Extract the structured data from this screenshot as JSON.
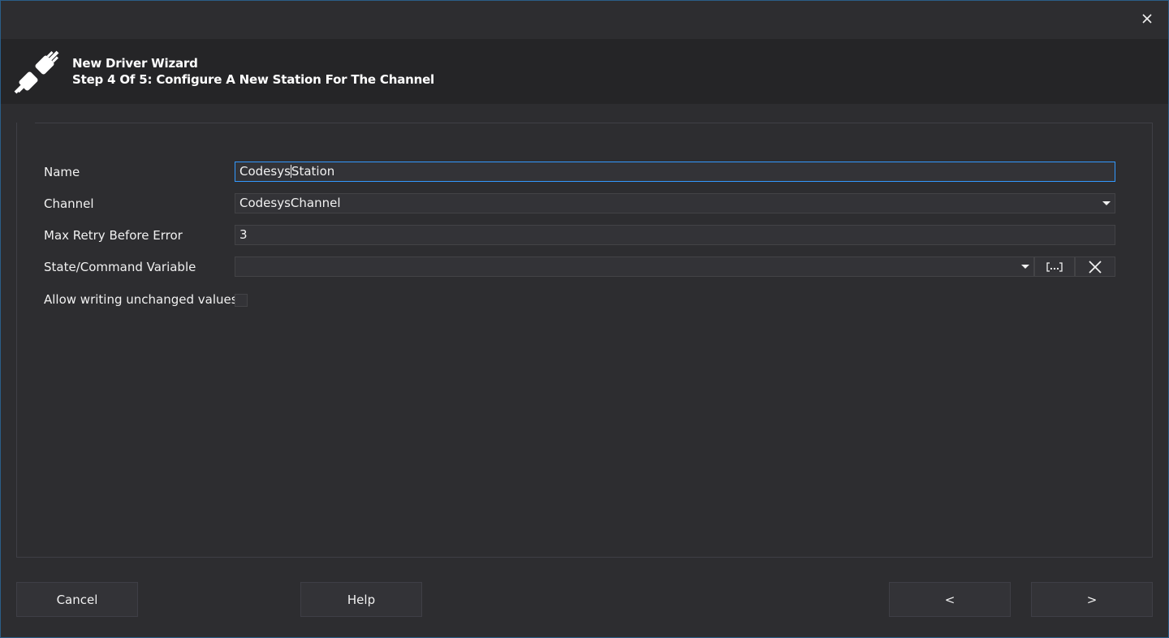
{
  "window": {
    "close_icon": "close-icon"
  },
  "header": {
    "icon": "plug-icon",
    "title": "New Driver Wizard",
    "subtitle": "Step 4 Of 5: Configure A New Station For The Channel"
  },
  "form": {
    "name": {
      "label": "Name",
      "value_before_caret": "Codesys",
      "value_after_caret": "Station"
    },
    "channel": {
      "label": "Channel",
      "value": "CodesysChannel"
    },
    "max_retry": {
      "label": "Max Retry Before Error",
      "value": "3"
    },
    "state_command": {
      "label": "State/Command Variable",
      "value": "",
      "browse_icon": "browse-icon",
      "clear_icon": "clear-icon"
    },
    "allow_writing": {
      "label": "Allow writing unchanged values",
      "checked": false
    }
  },
  "footer": {
    "cancel": "Cancel",
    "help": "Help",
    "back": "<",
    "next": ">"
  },
  "colors": {
    "background": "#2d2d30",
    "header_background": "#252527",
    "field_background": "#333337",
    "focus_border": "#3399ff",
    "window_border": "#2a5d87"
  }
}
